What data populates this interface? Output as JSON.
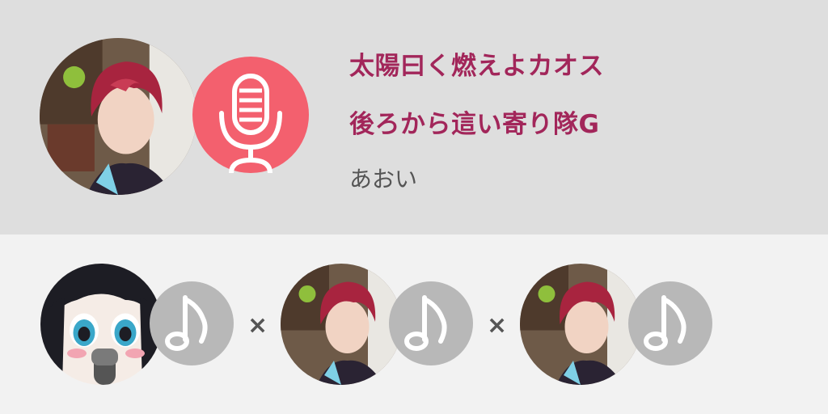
{
  "song": {
    "title_line1": "太陽曰く燃えよカオス",
    "title_line2": "後ろから這い寄り隊G",
    "artist": "あおい"
  },
  "main": {
    "avatar_icon": "user-photo",
    "badge_icon": "microphone-icon",
    "badge_color": "#f3606e"
  },
  "collab": {
    "separator_1": "×",
    "separator_2": "×",
    "participants": [
      {
        "avatar_icon": "anime-character-avatar",
        "badge_icon": "music-note-icon"
      },
      {
        "avatar_icon": "user-photo",
        "badge_icon": "music-note-icon"
      },
      {
        "avatar_icon": "user-photo",
        "badge_icon": "music-note-icon"
      }
    ],
    "badge_color": "#b8b8b8"
  },
  "colors": {
    "header_bg": "#dedede",
    "body_bg": "#f2f2f2",
    "title_color": "#a2265a",
    "artist_color": "#555555"
  }
}
